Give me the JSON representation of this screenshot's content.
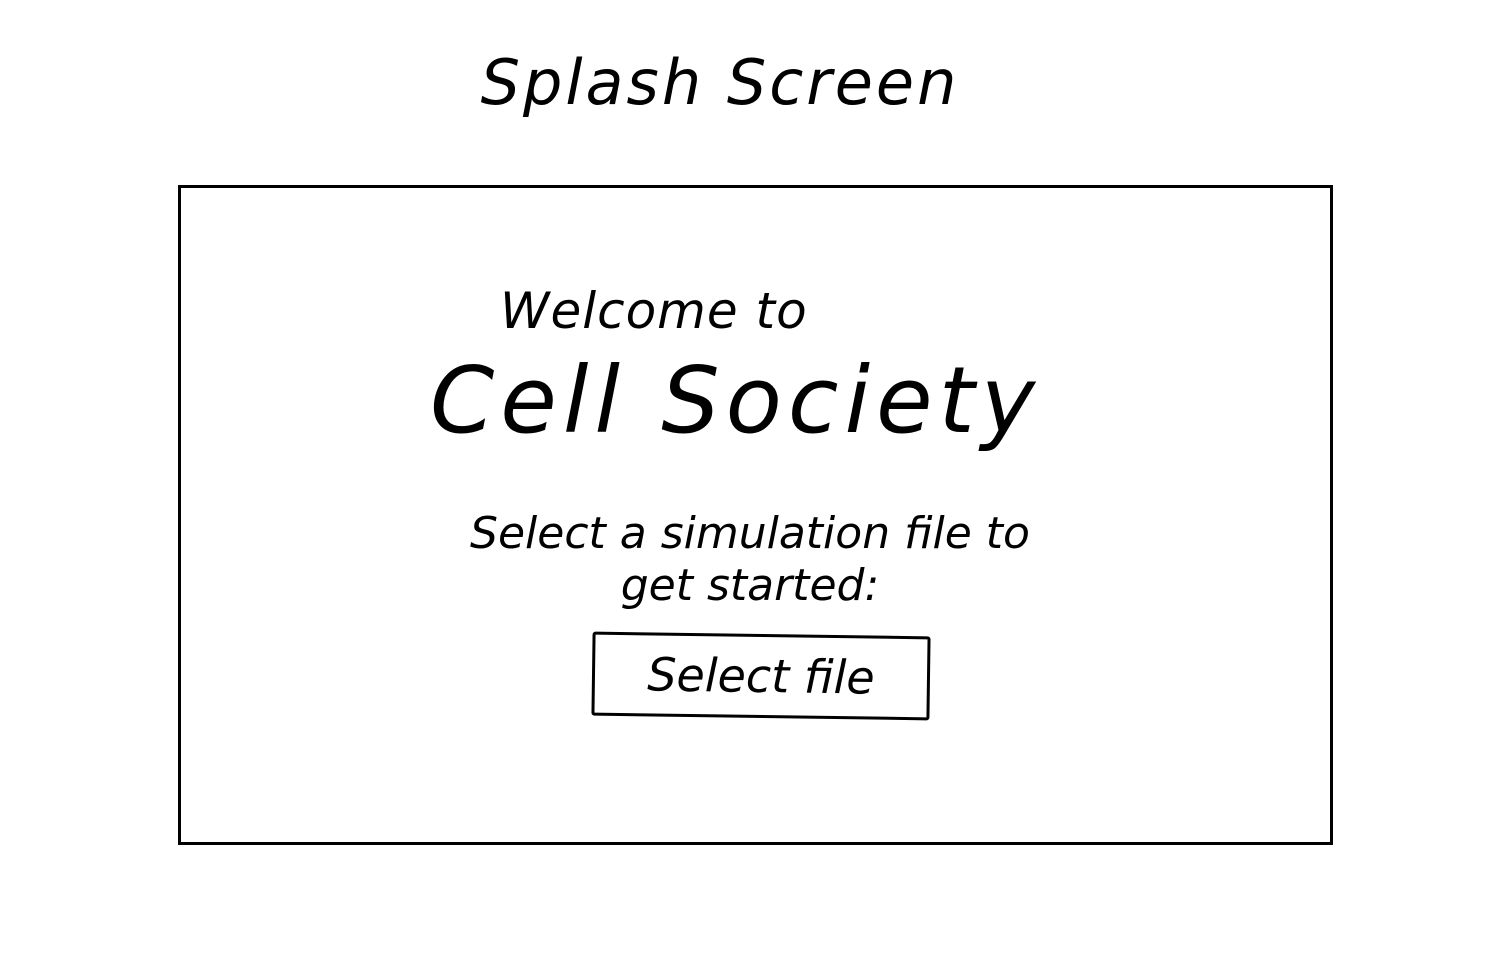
{
  "sketch": {
    "title": "Splash Screen"
  },
  "splash": {
    "welcome": "Welcome to",
    "app_name": "Cell Society",
    "instruction_line1": "Select a simulation file to",
    "instruction_line2": "get started:",
    "select_file_label": "Select file"
  },
  "colors": {
    "ink": "#000000",
    "paper": "#ffffff"
  }
}
